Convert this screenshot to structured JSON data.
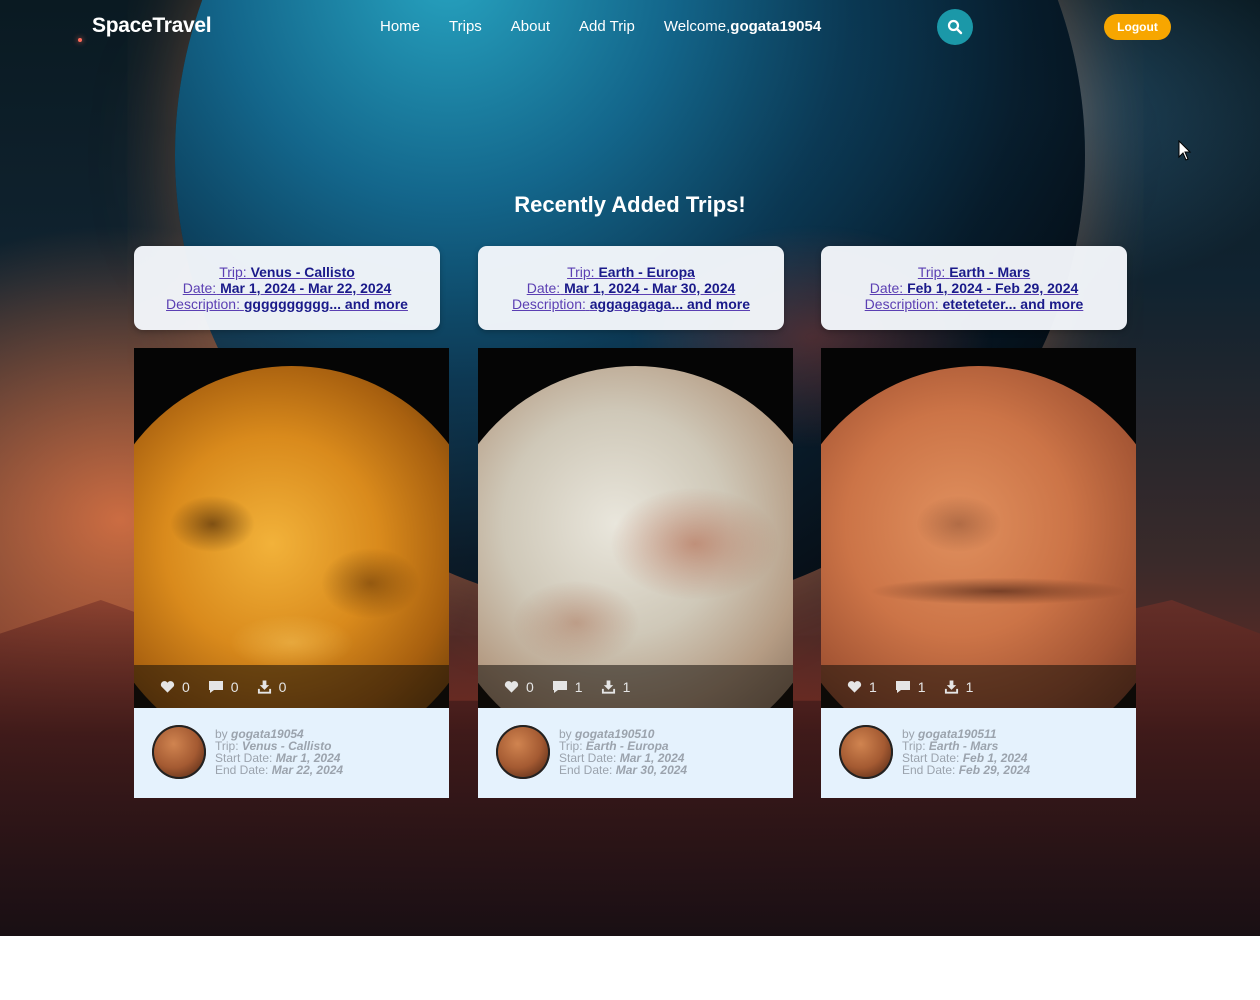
{
  "nav": {
    "brand": "SpaceTravel",
    "links": [
      "Home",
      "Trips",
      "About",
      "Add Trip"
    ],
    "welcome_prefix": "Welcome,",
    "username": "gogata19054",
    "logout": "Logout"
  },
  "heading": "Recently Added Trips!",
  "trips": [
    {
      "trip_label": "Trip:",
      "trip": "Venus - Callisto",
      "date_label": "Date:",
      "date": "Mar 1, 2024 - Mar 22, 2024",
      "desc_label": "Description:",
      "desc": "gggggggggg... and more",
      "likes": "0",
      "comments": "0",
      "downloads": "0",
      "by_label": "by",
      "author": "gogata19054",
      "start_label": "Start Date:",
      "start": "Mar 1, 2024",
      "end_label": "End Date:",
      "end": "Mar 22, 2024"
    },
    {
      "trip_label": "Trip:",
      "trip": "Earth - Europa",
      "date_label": "Date:",
      "date": "Mar 1, 2024 - Mar 30, 2024",
      "desc_label": "Description:",
      "desc": "aggagagaga... and more",
      "likes": "0",
      "comments": "1",
      "downloads": "1",
      "by_label": "by",
      "author": "gogata190510",
      "start_label": "Start Date:",
      "start": "Mar 1, 2024",
      "end_label": "End Date:",
      "end": "Mar 30, 2024"
    },
    {
      "trip_label": "Trip:",
      "trip": "Earth - Mars",
      "date_label": "Date:",
      "date": "Feb 1, 2024 - Feb 29, 2024",
      "desc_label": "Description:",
      "desc": "etetetеter... and more",
      "likes": "1",
      "comments": "1",
      "downloads": "1",
      "by_label": "by",
      "author": "gogata190511",
      "start_label": "Start Date:",
      "start": "Feb 1, 2024",
      "end_label": "End Date:",
      "end": "Feb 29, 2024"
    }
  ]
}
